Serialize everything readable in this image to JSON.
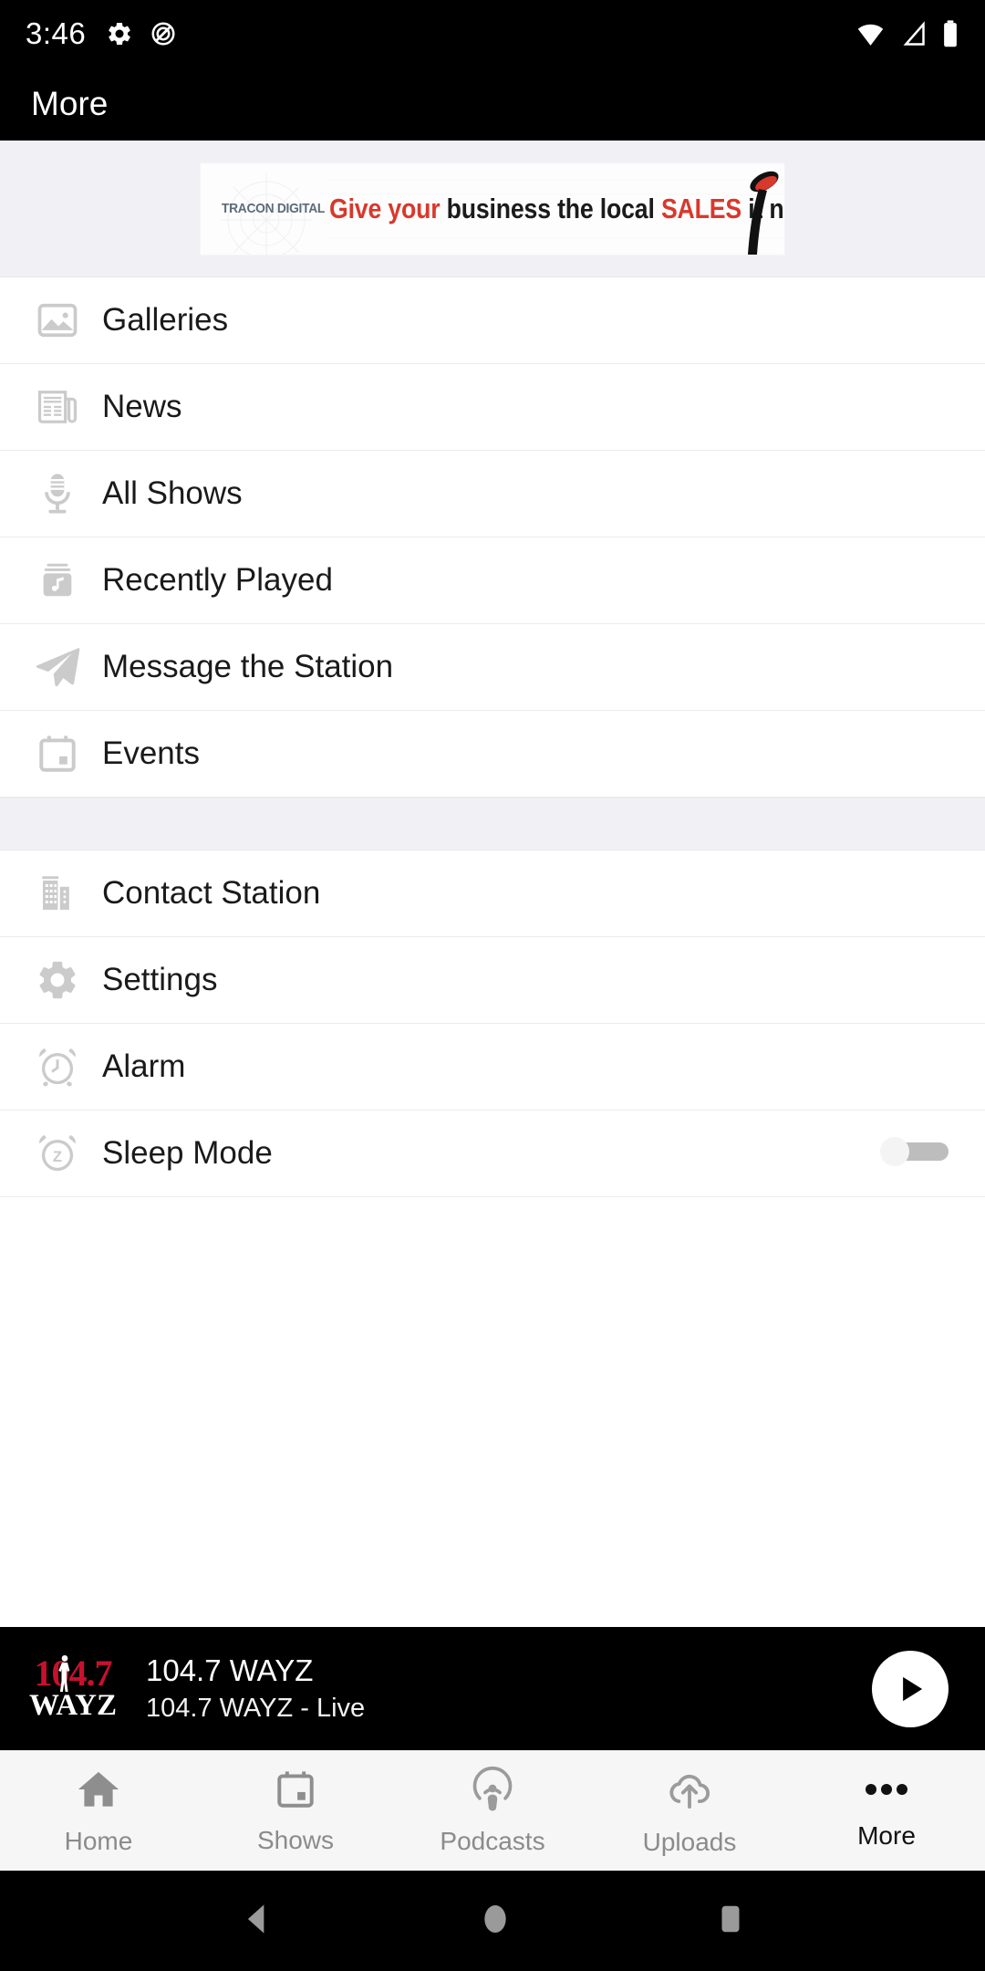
{
  "status_bar": {
    "time": "3:46",
    "icons": [
      "gear-icon",
      "do-not-disturb-icon",
      "wifi-icon",
      "cellular-signal-icon",
      "battery-icon"
    ]
  },
  "header": {
    "title": "More"
  },
  "ad": {
    "logo_text": "TRACON DIGITAL",
    "headline_part1": "Give your",
    "headline_part2": " business the local ",
    "headline_part3": "SALES",
    "headline_part4": " it needs",
    "accent_color": "#d9382c"
  },
  "menu": {
    "group1": [
      {
        "label": "Galleries",
        "icon": "image-icon"
      },
      {
        "label": "News",
        "icon": "newspaper-icon"
      },
      {
        "label": "All Shows",
        "icon": "microphone-icon"
      },
      {
        "label": "Recently Played",
        "icon": "music-library-icon"
      },
      {
        "label": "Message the Station",
        "icon": "paper-plane-icon"
      },
      {
        "label": "Events",
        "icon": "calendar-icon"
      }
    ],
    "group2": [
      {
        "label": "Contact Station",
        "icon": "building-icon"
      },
      {
        "label": "Settings",
        "icon": "gear-icon"
      },
      {
        "label": "Alarm",
        "icon": "alarm-clock-icon"
      },
      {
        "label": "Sleep Mode",
        "icon": "sleep-timer-icon",
        "has_toggle": true
      }
    ]
  },
  "now_playing": {
    "logo_top": "104.7",
    "logo_bottom": "WAYZ",
    "title": "104.7 WAYZ",
    "subtitle": "104.7 WAYZ - Live",
    "play_state": "paused",
    "logo_red": "#c8102e"
  },
  "bottom_nav": {
    "items": [
      {
        "label": "Home",
        "icon": "home-icon",
        "active": false
      },
      {
        "label": "Shows",
        "icon": "calendar-icon",
        "active": false
      },
      {
        "label": "Podcasts",
        "icon": "podcast-icon",
        "active": false
      },
      {
        "label": "Uploads",
        "icon": "cloud-upload-icon",
        "active": false
      },
      {
        "label": "More",
        "icon": "ellipsis-icon",
        "active": true
      }
    ]
  },
  "android_nav": {
    "buttons": [
      "back-button",
      "home-button",
      "recents-button"
    ]
  }
}
